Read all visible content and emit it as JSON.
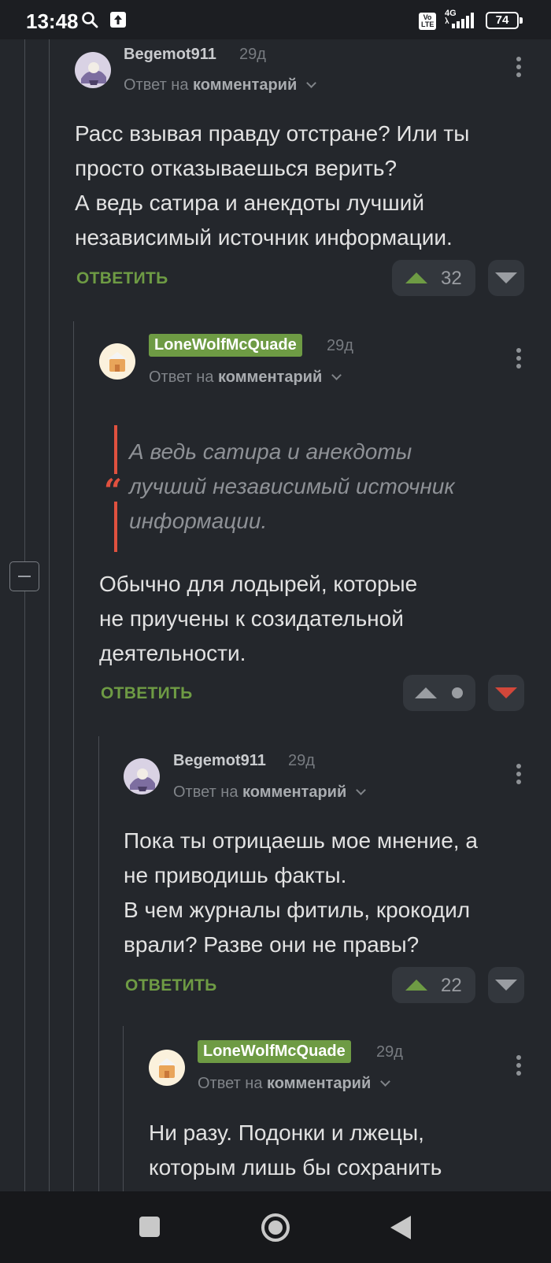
{
  "status_bar": {
    "time": "13:48",
    "network": "4G",
    "volte": "Vo LTE",
    "battery": "74"
  },
  "comments": [
    {
      "author": "Begemot911",
      "time_ago": "29д",
      "reply_prefix": "Ответ на",
      "reply_target": "комментарий",
      "body": [
        "Расс взывая правду отстране? Или ты",
        "просто отказываешься верить?",
        "А ведь сатира и анекдоты лучший",
        "независимый источник информации."
      ],
      "reply_label": "ОТВЕТИТЬ",
      "votes": "32"
    },
    {
      "author": "LoneWolfMcQuade",
      "time_ago": "29д",
      "reply_prefix": "Ответ на",
      "reply_target": "комментарий",
      "quote": [
        "А ведь сатира и анекдоты",
        "лучший независимый источник",
        "информации."
      ],
      "body": [
        "Обычно для лодырей, которые",
        "не приучены к созидательной",
        "деятельности."
      ],
      "reply_label": "ОТВЕТИТЬ"
    },
    {
      "author": "Begemot911",
      "time_ago": "29д",
      "reply_prefix": "Ответ на",
      "reply_target": "комментарий",
      "body": [
        "Пока ты отрицаешь мое мнение, а",
        "не приводишь факты.",
        "В чем журналы фитиль, крокодил",
        "врали? Разве они не правы?"
      ],
      "reply_label": "ОТВЕТИТЬ",
      "votes": "22"
    },
    {
      "author": "LoneWolfMcQuade",
      "time_ago": "29д",
      "reply_prefix": "Ответ на",
      "reply_target": "комментарий",
      "body": [
        "Ни разу. Подонки и лжецы,",
        "которым лишь бы сохранить"
      ]
    }
  ],
  "colors": {
    "background": "#24272c",
    "accent_green": "#6e9b44",
    "text": "#dcdcdc",
    "muted": "#8a8d91",
    "quote_bar": "#e0513f"
  }
}
